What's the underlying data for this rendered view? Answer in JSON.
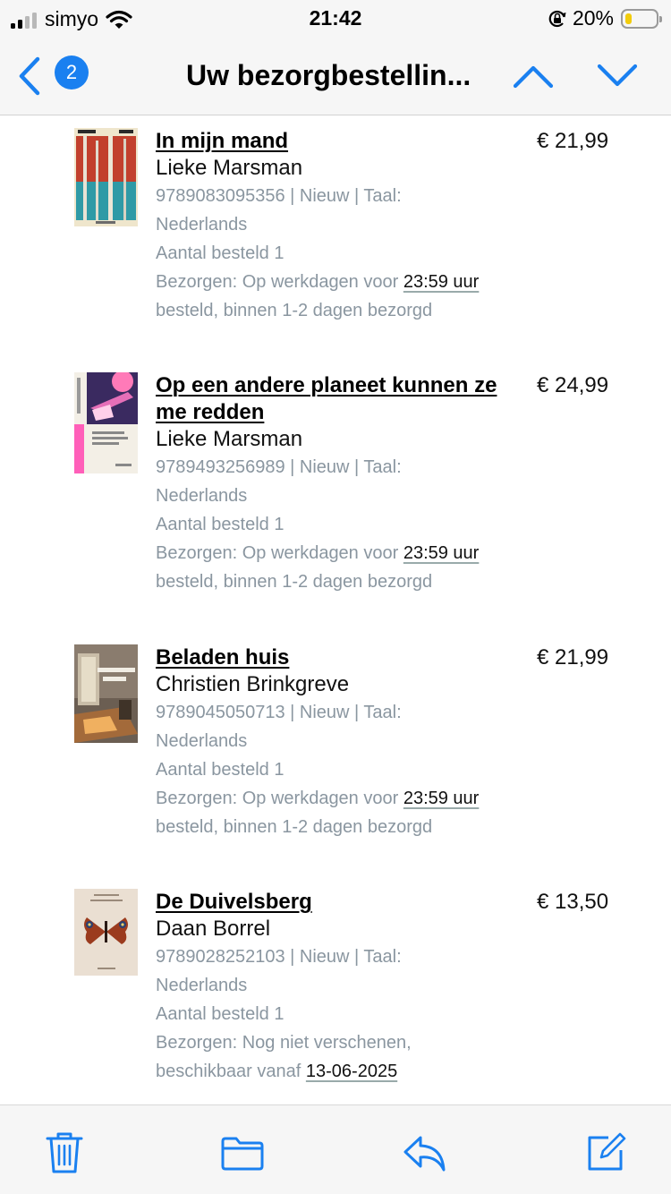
{
  "status_bar": {
    "carrier": "simyo",
    "time": "21:42",
    "battery_percent": "20%",
    "battery_level": 0.2,
    "signal_bars_filled": 2,
    "signal_bars_total": 4
  },
  "nav": {
    "title": "Uw bezorgbestellin...",
    "unread_count": "2",
    "back_icon": "chevron-left-icon",
    "prev_icon": "chevron-up-icon",
    "next_icon": "chevron-down-icon",
    "accent_color": "#1a80f0"
  },
  "orders": [
    {
      "title": "In mijn mand",
      "author": "Lieke Marsman",
      "meta_line1": "9789083095356 | Nieuw | Taal:",
      "meta_line2": "Nederlands",
      "quantity": "Aantal besteld 1",
      "delivery_prefix": "Bezorgen: Op werkdagen voor ",
      "delivery_link": "23:59 uur",
      "delivery_line2": "besteld, binnen 1-2 dagen bezorgd",
      "price": "€ 21,99"
    },
    {
      "title": "Op een andere planeet kunnen ze me redden",
      "author": "Lieke Marsman",
      "meta_line1": "9789493256989 | Nieuw | Taal:",
      "meta_line2": "Nederlands",
      "quantity": "Aantal besteld 1",
      "delivery_prefix": "Bezorgen: Op werkdagen voor ",
      "delivery_link": "23:59 uur",
      "delivery_line2": "besteld, binnen 1-2 dagen bezorgd",
      "price": "€ 24,99"
    },
    {
      "title": "Beladen huis",
      "author": "Christien Brinkgreve",
      "meta_line1": "9789045050713 | Nieuw | Taal:",
      "meta_line2": "Nederlands",
      "quantity": "Aantal besteld 1",
      "delivery_prefix": "Bezorgen: Op werkdagen voor ",
      "delivery_link": "23:59 uur",
      "delivery_line2": "besteld, binnen 1-2 dagen bezorgd",
      "price": "€ 21,99"
    },
    {
      "title": "De Duivelsberg",
      "author": "Daan Borrel",
      "meta_line1": "9789028252103 | Nieuw | Taal:",
      "meta_line2": "Nederlands",
      "quantity": "Aantal besteld 1",
      "delivery_prefix": "Bezorgen: Nog niet verschenen,",
      "delivery_link": "",
      "delivery_line2_prefix": "beschikbaar vanaf ",
      "delivery_line2_link": "13-06-2025",
      "price": "€ 13,50"
    }
  ],
  "toolbar": {
    "icons": [
      "trash-icon",
      "folder-icon",
      "reply-icon",
      "compose-icon"
    ]
  }
}
